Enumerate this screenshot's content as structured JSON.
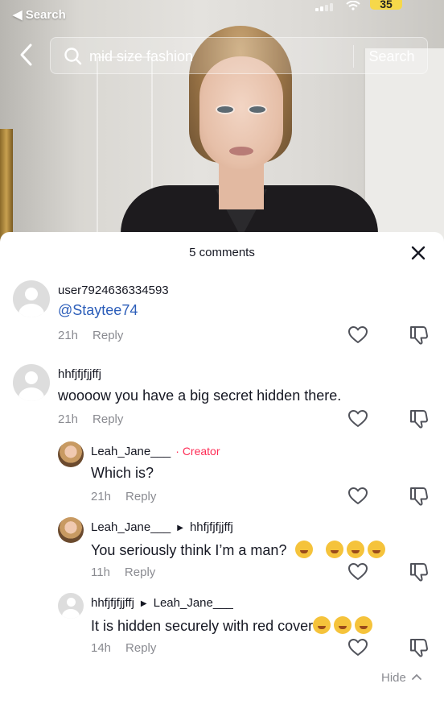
{
  "status_bar": {
    "back_label": "◀ Search",
    "battery": "35"
  },
  "search": {
    "query": "mid size fashion",
    "button_label": "Search"
  },
  "sheet": {
    "title": "5 comments",
    "hide_label": "Hide"
  },
  "comments": [
    {
      "username": "user7924636334593",
      "text": "@Staytee74",
      "time": "21h",
      "reply_label": "Reply"
    },
    {
      "username": "hhfjfjfjjffj",
      "text": "woooow you have a big secret hidden there.",
      "time": "21h",
      "reply_label": "Reply"
    }
  ],
  "replies": [
    {
      "username": "Leah_Jane___",
      "badge": "· Creator",
      "text": "Which is?",
      "time": "21h",
      "reply_label": "Reply"
    },
    {
      "username": "Leah_Jane___",
      "reply_to": "hhfjfjfjjffj",
      "text": "You seriously think I’m a man?",
      "time": "11h",
      "reply_label": "Reply"
    },
    {
      "username": "hhfjfjfjjffj",
      "reply_to": "Leah_Jane___",
      "text": "It is hidden securely with red cover",
      "time": "14h",
      "reply_label": "Reply"
    }
  ],
  "icons": {
    "like": "heart-outline-icon",
    "dislike": "thumbs-down-icon",
    "close": "close-icon",
    "back": "chevron-left-icon",
    "search": "search-icon"
  },
  "colors": {
    "creator": "#fe2c55",
    "mention": "#2b5db9",
    "meta": "#8a8b91",
    "battery": "#f6d84a"
  }
}
